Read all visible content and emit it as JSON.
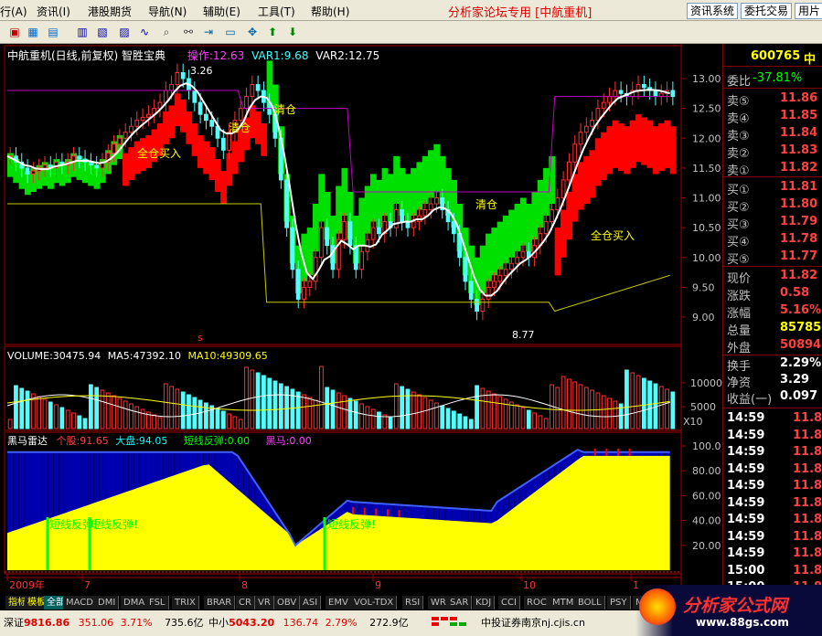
{
  "menubar": {
    "items": [
      "行(A)",
      "资讯(I)",
      "港股期货",
      "导航(N)",
      "辅助(E)",
      "工具(T)",
      "帮助(H)"
    ],
    "banner": "分析家论坛专用 [中航重机]",
    "buttons": [
      "资讯系统",
      "委托交易",
      "用片"
    ]
  },
  "stock": {
    "title": "中航重机(日线,前复权) 智胜宝典",
    "op_label": "操作:12.63",
    "var1": "VAR1:9.68",
    "var2": "VAR2:12.75",
    "code": "600765"
  },
  "annotations": {
    "high": "3.26",
    "low": "8.77",
    "buy1": "全仓买入",
    "buy2": "全仓买入",
    "sell1": "清仓",
    "sell2": "清仓",
    "sell3": "清仓",
    "marker": "s"
  },
  "price_axis": [
    "13.00",
    "12.50",
    "12.00",
    "11.50",
    "11.00",
    "10.50",
    "10.00",
    "9.50",
    "9.00"
  ],
  "volume": {
    "title": "VOLUME:30475.94",
    "ma5": "MA5:47392.10",
    "ma10": "MA10:49309.65",
    "ticks": [
      "10000",
      "5000"
    ],
    "unit": "X10"
  },
  "indicator": {
    "name": "黑马雷达",
    "a": "个股:91.65",
    "b": "大盘:94.05",
    "c": "短线反弹:0.00",
    "d": "黑马:0.00",
    "ticks": [
      "100.0",
      "80.00",
      "60.00",
      "40.00",
      "20.00"
    ],
    "label1": "短线反弹!",
    "label2": "短线反弹!",
    "label3": "短线反弹!"
  },
  "dates": [
    "2009年",
    "7",
    "8",
    "9",
    "10",
    "1"
  ],
  "quote": {
    "ratio_label": "委比",
    "ratio_value": "-37.81%",
    "asks": [
      {
        "l": "卖⑤",
        "v": "11.86"
      },
      {
        "l": "卖④",
        "v": "11.85"
      },
      {
        "l": "卖③",
        "v": "11.84"
      },
      {
        "l": "卖②",
        "v": "11.83"
      },
      {
        "l": "卖①",
        "v": "11.82"
      }
    ],
    "bids": [
      {
        "l": "买①",
        "v": "11.81"
      },
      {
        "l": "买②",
        "v": "11.80"
      },
      {
        "l": "买③",
        "v": "11.79"
      },
      {
        "l": "买④",
        "v": "11.78"
      },
      {
        "l": "买⑤",
        "v": "11.77"
      }
    ],
    "stats": [
      {
        "l": "现价",
        "v": "11.82"
      },
      {
        "l": "涨跌",
        "v": "0.58"
      },
      {
        "l": "涨幅",
        "v": "5.16%"
      },
      {
        "l": "总量",
        "v": "85785"
      },
      {
        "l": "外盘",
        "v": "50894"
      }
    ],
    "extra": [
      {
        "l": "换手",
        "v": "2.29%"
      },
      {
        "l": "净资",
        "v": "3.29"
      },
      {
        "l": "收益(一)",
        "v": "0.097"
      }
    ],
    "ticks": [
      {
        "t": "14:59",
        "v": "11.8"
      },
      {
        "t": "14:59",
        "v": "11.8"
      },
      {
        "t": "14:59",
        "v": "11.8"
      },
      {
        "t": "14:59",
        "v": "11.8"
      },
      {
        "t": "14:59",
        "v": "11.8"
      },
      {
        "t": "14:59",
        "v": "11.8"
      },
      {
        "t": "14:59",
        "v": "11.8"
      },
      {
        "t": "14:59",
        "v": "11.8"
      },
      {
        "t": "14:59",
        "v": "11.8"
      },
      {
        "t": "15:00",
        "v": "11.8"
      },
      {
        "t": "15:00",
        "v": "11.8"
      }
    ]
  },
  "bottom_tabs": [
    "指标",
    "模板",
    "全部",
    "MACD",
    "DMI",
    "DMA",
    "FSL",
    "TRIX",
    "BRAR",
    "CR",
    "VR",
    "OBV",
    "ASI",
    "EMV",
    "VOL-TDX",
    "RSI",
    "WR",
    "SAR",
    "KDJ",
    "CCI",
    "ROC",
    "MTM",
    "BOLL",
    "PSY",
    "MCS"
  ],
  "status": {
    "sh_label": "深证",
    "sh_val": "9816.86",
    "sh_chg": "351.06",
    "sh_pct": "3.71%",
    "sh_amt": "735.6亿",
    "sz_label": "中小",
    "sz_val": "5043.20",
    "sz_chg": "136.74",
    "sz_pct": "2.79%",
    "sz_amt": "272.9亿",
    "broker": "中投证券南京nj.cjis.cn"
  },
  "logo": {
    "text": "分析家公式网",
    "url": "www.88gs.com"
  },
  "colors": {
    "up": "#ff3030",
    "down": "#54fcfc",
    "green": "#00ff00",
    "yellow": "#ffff00",
    "blue": "#0000c0",
    "magenta": "#d000d0"
  }
}
